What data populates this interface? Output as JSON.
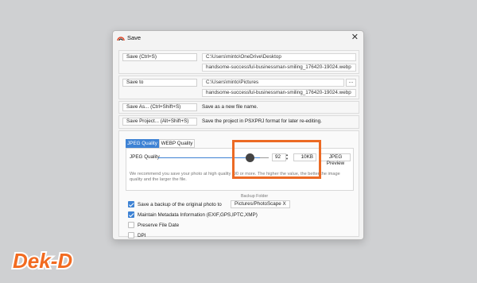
{
  "dialog": {
    "title": "Save",
    "close": "✕"
  },
  "save": {
    "button": "Save   (Ctrl+S)",
    "path": "C:\\Users\\minto\\OneDrive\\Desktop",
    "filename": "handsome-successful-businessman-smiling_176420-19024.webp"
  },
  "save_to": {
    "button": "Save to",
    "path": "C:\\Users\\minto\\Pictures",
    "browse": "...",
    "filename": "handsome-successful-businessman-smiling_176420-19024.webp"
  },
  "save_as": {
    "button": "Save As...   (Ctrl+Shift+S)",
    "description": "Save as a new file name."
  },
  "save_project": {
    "button": "Save Project...   (Alt+Shift+S)",
    "description": "Save the project in PSXPRJ format for later re-editing."
  },
  "quality": {
    "tabs": [
      "JPEG Quality",
      "WEBP Quality"
    ],
    "label": "JPEG Quality",
    "value": "92",
    "value_fraction": 0.92,
    "size": "10KB",
    "preview": "JPEG Preview",
    "help": "We recommend you save your photo at high quality (90 or more. The higher the value, the better the image quality and the larger the file."
  },
  "options": {
    "backup_folder_label": "Backup Folder",
    "backup": {
      "label": "Save a backup of the original photo to",
      "checked": true,
      "folder": "Pictures/PhotoScape X"
    },
    "metadata": {
      "label": "Maintain Metadata Information (EXIF,GPS,IPTC,XMP)",
      "checked": true
    },
    "preserve_date": {
      "label": "Preserve File Date",
      "checked": false
    },
    "dpi": {
      "label": "DPI",
      "checked": false
    }
  },
  "watermark": {
    "text": "Dek-D"
  },
  "colors": {
    "accent": "#3d82d4",
    "highlight": "#ec6a24",
    "watermark": "#f26b21"
  }
}
